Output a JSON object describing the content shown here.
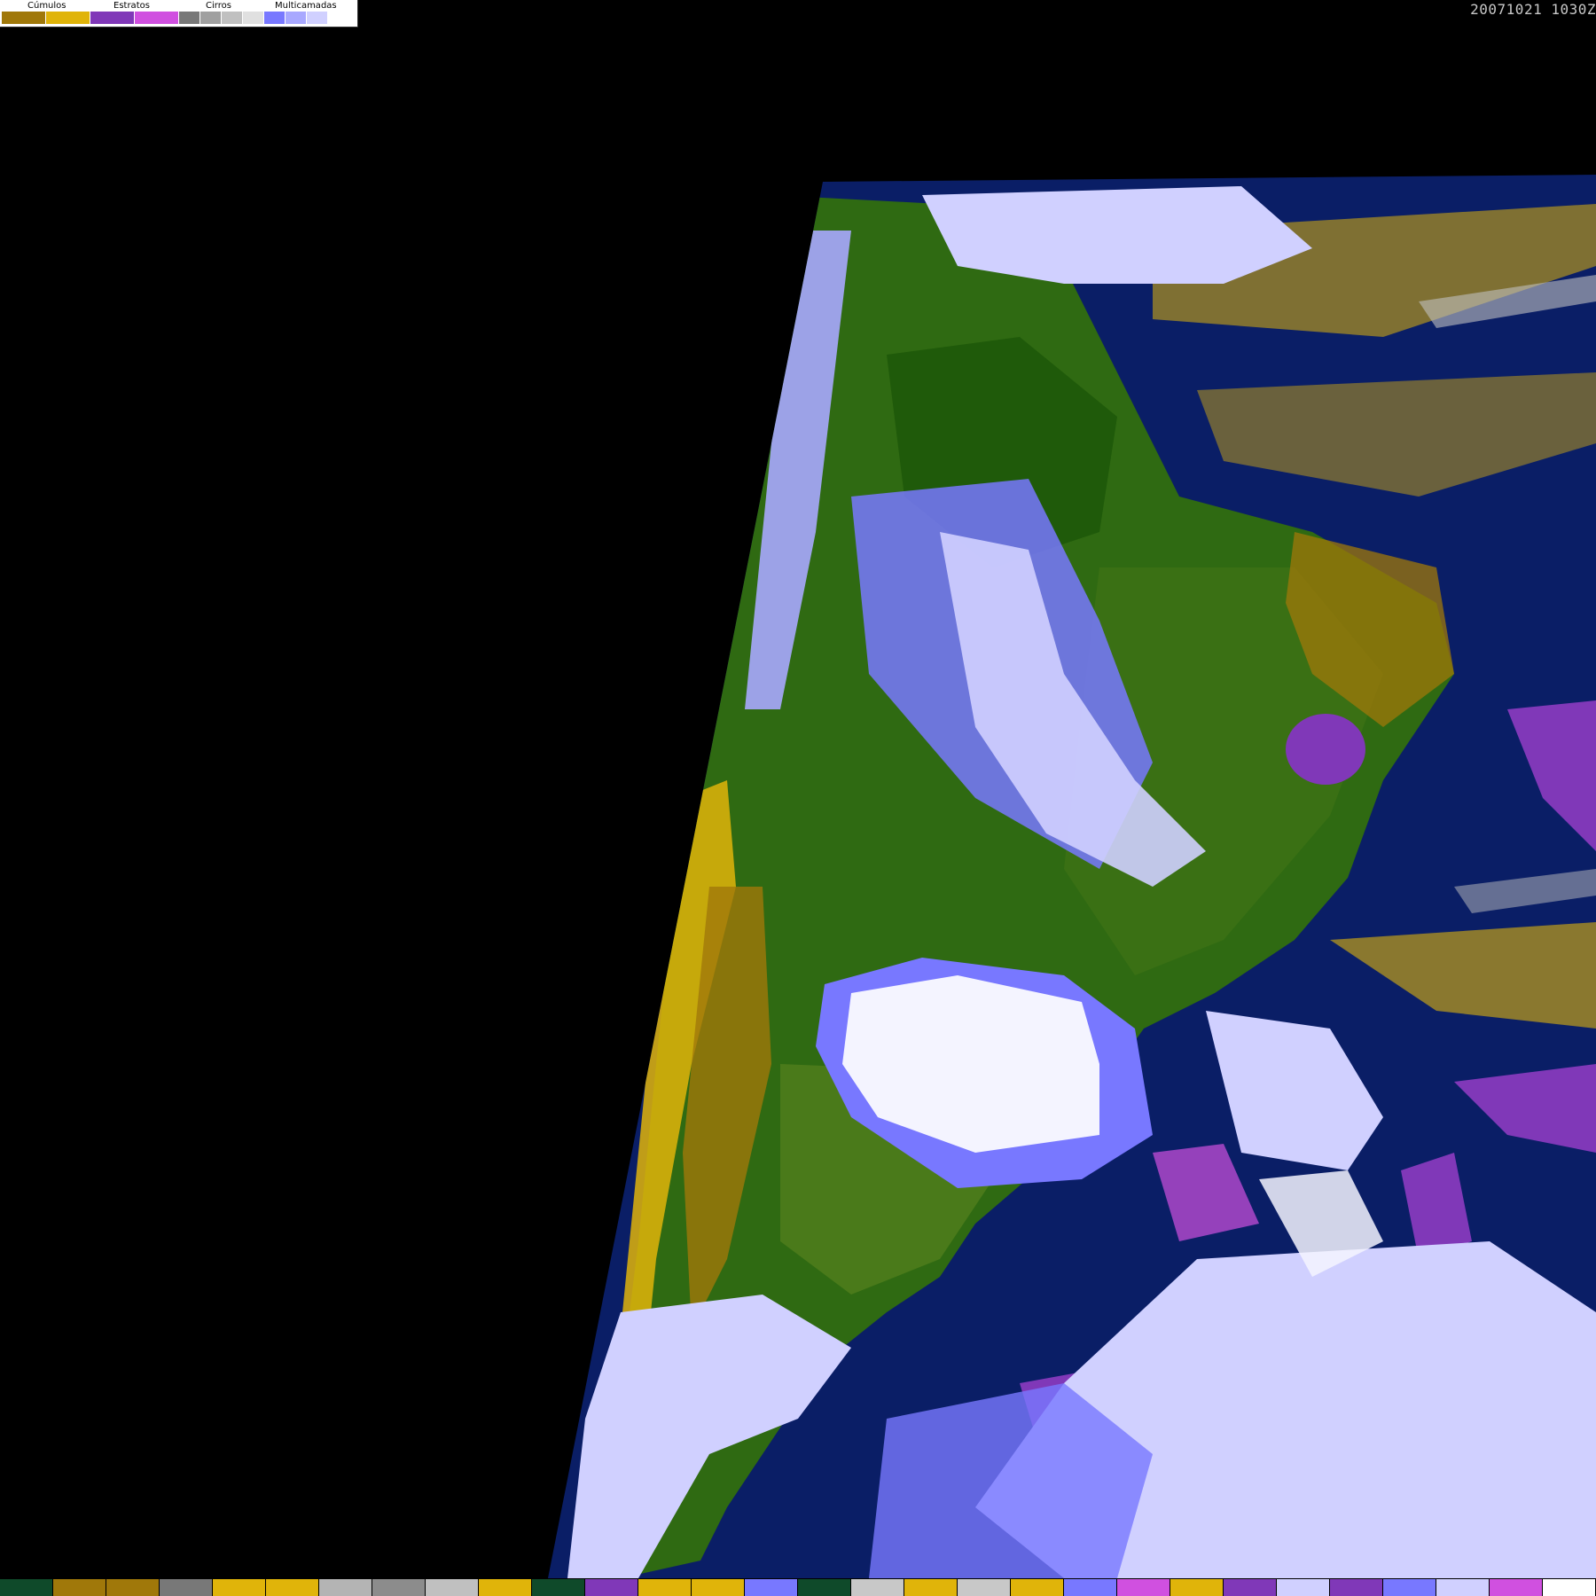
{
  "legend": {
    "categories": [
      {
        "label": "Cúmulos",
        "colors": [
          "#a0780a",
          "#e0b40a"
        ]
      },
      {
        "label": "Estratos",
        "colors": [
          "#8038b8",
          "#d050e0"
        ]
      },
      {
        "label": "Cirros",
        "colors": [
          "#787878",
          "#a0a0a0",
          "#c0c0c0",
          "#e0e0e0"
        ]
      },
      {
        "label": "Multicamadas",
        "colors": [
          "#7878ff",
          "#a8a8ff",
          "#d0d0ff",
          "#ffffff"
        ]
      }
    ]
  },
  "timestamp": "20071021 1030Z",
  "colors": {
    "background": "#000000",
    "ocean": "#0a1e66",
    "land": "#2f6a12",
    "land_dark": "#1f5a0a",
    "cumulus_dark": "#a0780a",
    "cumulus_light": "#e0b40a",
    "stratus_dark": "#8038b8",
    "stratus_light": "#d050e0",
    "cirrus_gray": "#a0a0a0",
    "multi_blue": "#7878ff",
    "multi_light": "#d0d0ff",
    "multi_white": "#f4f4ff"
  },
  "bottom_bar_colors": [
    "#0f4a2a",
    "#a0780a",
    "#a0780a",
    "#787878",
    "#e0b40a",
    "#e0b40a",
    "#b4b4b4",
    "#8c8c8c",
    "#c0c0c0",
    "#e0b40a",
    "#0f4a2a",
    "#8038b8",
    "#e0b40a",
    "#e0b40a",
    "#7878ff",
    "#0f4a2a",
    "#c8c8c8",
    "#e0b40a",
    "#c8c8c8",
    "#e0b40a",
    "#7878ff",
    "#d050e0",
    "#e0b40a",
    "#8038b8",
    "#d0d0ff",
    "#8038b8",
    "#7878ff",
    "#d0d0ff",
    "#d050e0",
    "#ffffff"
  ]
}
